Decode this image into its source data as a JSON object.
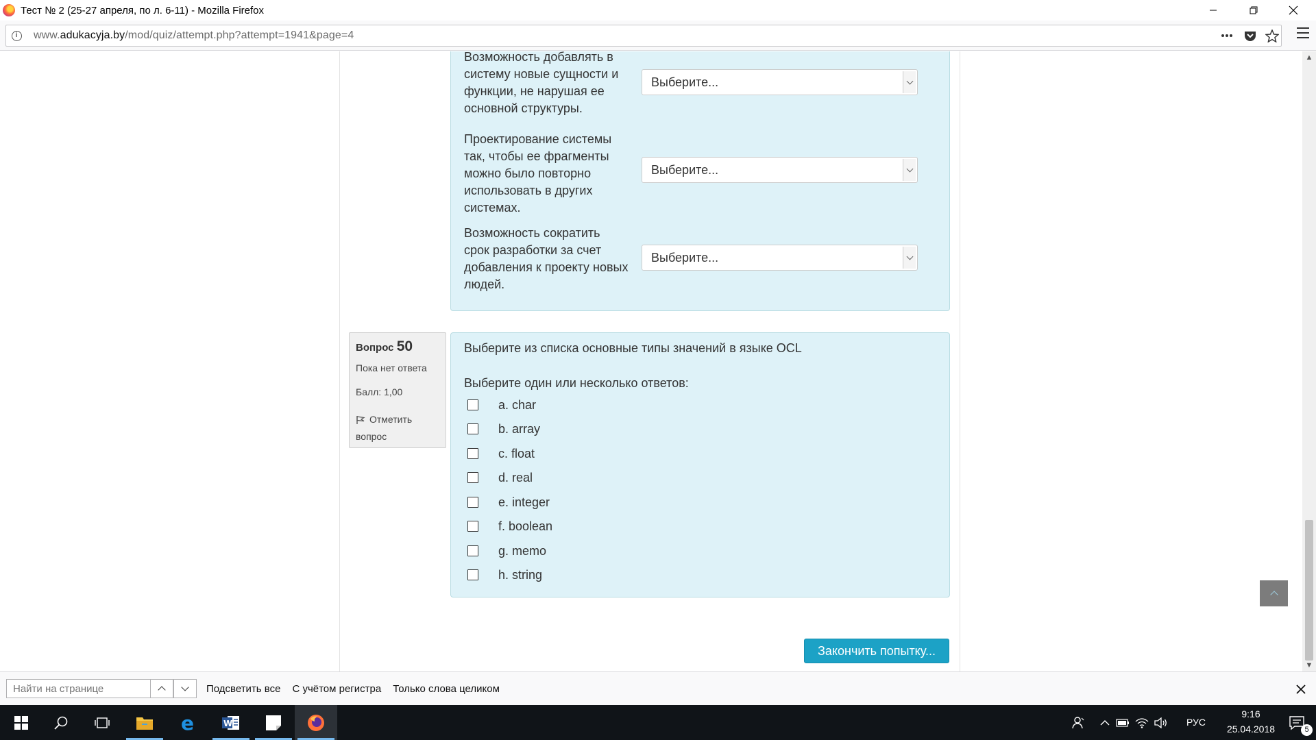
{
  "window": {
    "title": "Тест № 2 (25-27 апреля, по л. 6-11) - Mozilla Firefox",
    "minimize_icon": "minimize-icon",
    "restore_icon": "restore-icon",
    "close_icon": "close-icon"
  },
  "navbar": {
    "url_prefix": "www.",
    "url_domain": "adukacyja.by",
    "url_path": "/mod/quiz/attempt.php?attempt=1941&page=4"
  },
  "matching": {
    "rows": [
      {
        "label": "Возможность добавлять в систему новые сущности и функции, не нарушая ее основной структуры.",
        "value": "Выберите..."
      },
      {
        "label": "Проектирование системы так, чтобы ее фрагменты можно было повторно использовать в других системах.",
        "value": "Выберите..."
      },
      {
        "label": "Возможность сократить срок разработки за счет добавления к проекту новых людей.",
        "value": "Выберите..."
      }
    ]
  },
  "question": {
    "prefix": "Вопрос",
    "number": "50",
    "status": "Пока нет ответа",
    "grade": "Балл: 1,00",
    "flag_label": "Отметить вопрос",
    "text": "Выберите из списка основные типы значений в языке OCL",
    "prompt": "Выберите один или несколько ответов:",
    "options": [
      {
        "label": "a. char",
        "checked": false
      },
      {
        "label": "b. array",
        "checked": false
      },
      {
        "label": "c. float",
        "checked": false
      },
      {
        "label": "d. real",
        "checked": false
      },
      {
        "label": "e. integer",
        "checked": false
      },
      {
        "label": "f. boolean",
        "checked": false
      },
      {
        "label": "g. memo",
        "checked": false
      },
      {
        "label": "h. string",
        "checked": false
      }
    ]
  },
  "finish_button": "Закончить попытку...",
  "findbar": {
    "placeholder": "Найти на странице",
    "highlight_all": "Подсветить все",
    "match_case": "С учётом регистра",
    "whole_words": "Только слова целиком"
  },
  "taskbar": {
    "language": "РУС",
    "time": "9:16",
    "date": "25.04.2018",
    "notification_count": "5"
  },
  "colors": {
    "question_bg": "#def2f8",
    "button_accent": "#1ca2c6",
    "taskbar_bg": "#101418"
  }
}
